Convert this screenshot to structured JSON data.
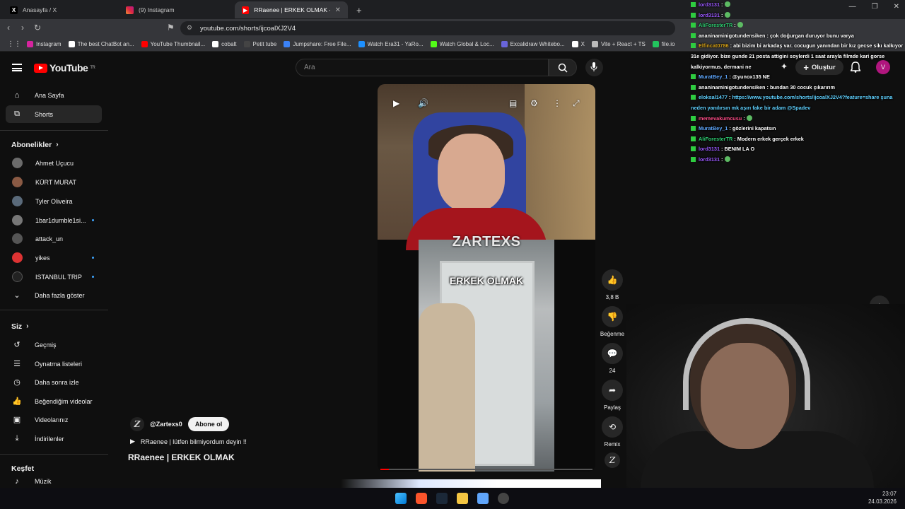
{
  "tabs": [
    {
      "label": "Anasayfa / X",
      "icon": "x-logo-icon"
    },
    {
      "label": "(9) Instagram",
      "icon": "instagram-icon"
    },
    {
      "label": "RRaenee | ERKEK OLMAK - YouTube",
      "icon": "youtube-icon"
    }
  ],
  "address": {
    "url": "youtube.com/shorts/ijcoalXJ2V4"
  },
  "bookmarks": [
    {
      "label": "Instagram",
      "color": "#d6249f"
    },
    {
      "label": "The best ChatBot an...",
      "color": "#ffffff"
    },
    {
      "label": "YouTube Thumbnail...",
      "color": "#ff0000"
    },
    {
      "label": "cobalt",
      "color": "#ffffff"
    },
    {
      "label": "Petit tube",
      "color": "#444444"
    },
    {
      "label": "Jumpshare: Free File...",
      "color": "#3b82f6"
    },
    {
      "label": "Watch Era31 - YaRo...",
      "color": "#1e90ff"
    },
    {
      "label": "Watch Global & Loc...",
      "color": "#53fc18"
    },
    {
      "label": "Excalidraw Whitebo...",
      "color": "#6965db"
    },
    {
      "label": "X",
      "color": "#ffffff"
    },
    {
      "label": "Vite + React + TS",
      "color": "#bbbbbb"
    },
    {
      "label": "file.io",
      "color": "#22c55e"
    }
  ],
  "header": {
    "logo_text": "YouTube",
    "logo_sup": "TR",
    "search_placeholder": "Ara",
    "create_label": "Oluştur",
    "avatar_letter": "V"
  },
  "sidebar": {
    "main": [
      {
        "label": "Ana Sayfa",
        "icon": "home-icon"
      },
      {
        "label": "Shorts",
        "icon": "shorts-icon",
        "active": true
      }
    ],
    "subs_heading": "Abonelikler",
    "subs": [
      {
        "label": "Ahmet Uçucu",
        "color": "#6b6b6b",
        "dot": false
      },
      {
        "label": "KÜRT MURAT",
        "color": "#8a5a44",
        "dot": false
      },
      {
        "label": "Tyler Oliveira",
        "color": "#5a6a7a",
        "dot": false
      },
      {
        "label": "1bar1dumble1si...",
        "color": "#777777",
        "dot": true
      },
      {
        "label": "attack_un",
        "color": "#555555",
        "dot": false
      },
      {
        "label": "yikes",
        "color": "#d33333",
        "dot": true
      },
      {
        "label": "ISTANBUL TRIP",
        "color": "#222222",
        "dot": true
      }
    ],
    "show_more": "Daha fazla göster",
    "you_heading": "Siz",
    "you": [
      {
        "label": "Geçmiş",
        "icon": "history-icon"
      },
      {
        "label": "Oynatma listeleri",
        "icon": "playlist-icon"
      },
      {
        "label": "Daha sonra izle",
        "icon": "clock-icon"
      },
      {
        "label": "Beğendiğim videolar",
        "icon": "like-icon"
      },
      {
        "label": "Videolarınız",
        "icon": "video-icon"
      },
      {
        "label": "İndirilenler",
        "icon": "download-icon"
      }
    ],
    "explore_heading": "Keşfet",
    "explore_first": "Müzik"
  },
  "video": {
    "caption_top": "ZARTEXS",
    "caption_mid": "ERKEK OLMAK",
    "progress": 0.04
  },
  "actions": {
    "likes": "3,8 B",
    "dislike_label": "Beğenme",
    "comments": "24",
    "share_label": "Paylaş",
    "remix_label": "Remix"
  },
  "channel": {
    "handle": "@Zartexs0",
    "subscribe": "Abone ol",
    "description": "RRaenee |  lütfen bilmiyordum deyin !!",
    "title": "RRaenee |   ERKEK OLMAK"
  },
  "chat": [
    {
      "user": "lord3131",
      "color": "#9b59ff",
      "msg": ""
    },
    {
      "user": "lord3131",
      "color": "#9b59ff",
      "msg": ""
    },
    {
      "user": "AliForesterTR",
      "color": "#2ecc71",
      "msg": ""
    },
    {
      "user": "ananinaminigotundensiken",
      "color": "#ffffff",
      "msg": "çok doğurgan duruyor bunu varya"
    },
    {
      "user": "Elfincat0786",
      "color": "#d4a017",
      "msg": "abi bizim bi arkadaş var. cocugun yanından bir kız gecse sikı kalkıyor 31e gidiyor. bize gunde 21 posta attigini soylerdi 1 saat arayla filmde kari gorse kalkiyormus. dermani ne"
    },
    {
      "user": "MuratBey_1",
      "color": "#5fa8ff",
      "msg": "@yunox135 NE"
    },
    {
      "user": "ananinaminigotundensiken",
      "color": "#ffffff",
      "msg": "bundan 30 cocuk çıkarırım"
    },
    {
      "user": "eloksal1477",
      "color": "#5fd1ff",
      "msg": "https://www.youtube.com/shorts/ijcoalXJ2V4?feature=share şuna neden yanılırsın mk aşırı fake bir adam @Spadev"
    },
    {
      "user": "memevakumcusu",
      "color": "#ff4d88",
      "msg": ""
    },
    {
      "user": "MuratBey_1",
      "color": "#5fa8ff",
      "msg": "gözlerini kapatsın"
    },
    {
      "user": "AliForesterTR",
      "color": "#2ecc71",
      "msg": "Modern erkek gerçek erkek"
    },
    {
      "user": "lord3131",
      "color": "#9b59ff",
      "msg": "BENIM LA O"
    },
    {
      "user": "lord3131",
      "color": "#9b59ff",
      "msg": ""
    }
  ],
  "clock": {
    "time": "23:07",
    "date": "24.03.2026"
  }
}
